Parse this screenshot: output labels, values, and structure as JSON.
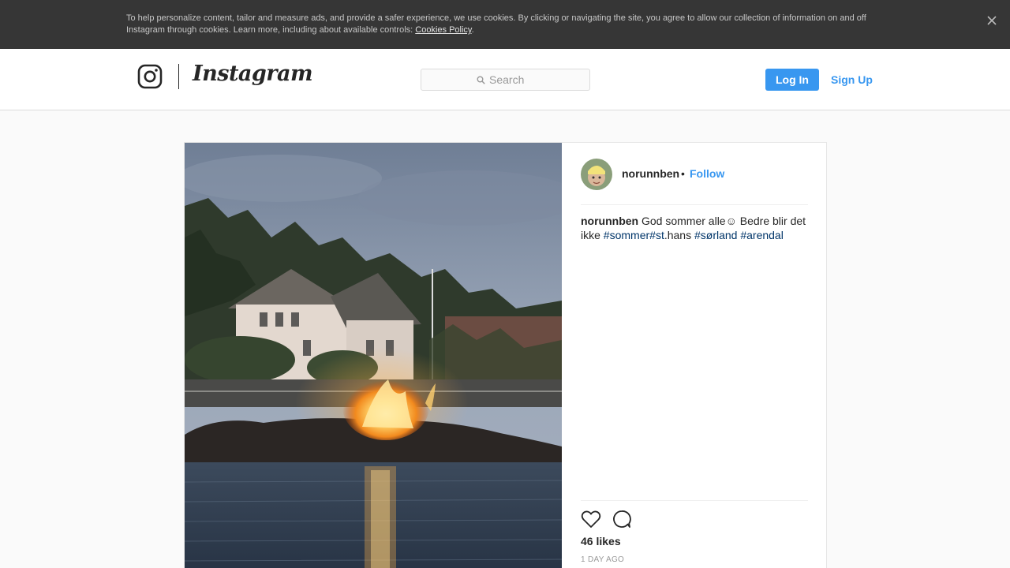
{
  "cookie_banner": {
    "text": "To help personalize content, tailor and measure ads, and provide a safer experience, we use cookies. By clicking or navigating the site, you agree to allow our collection of information on and off Instagram through cookies. Learn more, including about available controls: ",
    "link_label": "Cookies Policy",
    "link_suffix": ".",
    "close_icon": "close-icon"
  },
  "header": {
    "brand": "Instagram",
    "logo_icon": "instagram-glyph-icon",
    "search": {
      "placeholder": "Search",
      "icon": "search-icon"
    },
    "login_label": "Log In",
    "signup_label": "Sign Up"
  },
  "post": {
    "author": "norunnben",
    "separator": "•",
    "follow_label": "Follow",
    "caption": {
      "user": "norunnben",
      "text": " God sommer alle☺ Bedre blir det ikke ",
      "tag1": "#sommer",
      "tag2": "#st",
      "tag2_suffix": ".hans ",
      "tag3": "#sørland",
      "space": " ",
      "tag4": "#arendal"
    },
    "actions": {
      "like_icon": "heart-icon",
      "comment_icon": "comment-icon"
    },
    "likes": "46 likes",
    "time_ago": "1 DAY AGO"
  },
  "colors": {
    "accent": "#3897f0",
    "hashtag": "#003569",
    "banner_bg": "#363636"
  }
}
